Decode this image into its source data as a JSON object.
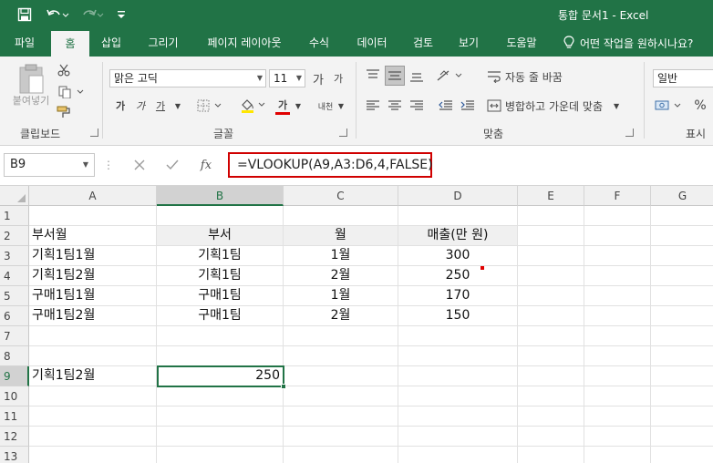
{
  "window": {
    "title": "통합 문서1  -  Excel"
  },
  "tabs": [
    {
      "label": "파일",
      "active": false
    },
    {
      "label": "홈",
      "active": true
    },
    {
      "label": "삽입",
      "active": false
    },
    {
      "label": "그리기",
      "active": false
    },
    {
      "label": "페이지 레이아웃",
      "active": false
    },
    {
      "label": "수식",
      "active": false
    },
    {
      "label": "데이터",
      "active": false
    },
    {
      "label": "검토",
      "active": false
    },
    {
      "label": "보기",
      "active": false
    },
    {
      "label": "도움말",
      "active": false
    }
  ],
  "tell_me": "어떤 작업을 원하시나요?",
  "ribbon": {
    "clipboard": {
      "paste_label": "붙여넣기",
      "group_label": "클립보드"
    },
    "font": {
      "font_name": "맑은 고딕",
      "font_size": "11",
      "grow_label": "가",
      "shrink_label": "가",
      "bold_label": "가",
      "italic_label": "가",
      "underline_label": "가",
      "fontcolor_label": "가",
      "phonetic_label": "내천",
      "group_label": "글꼴"
    },
    "alignment": {
      "wrap_label": "자동 줄 바꿈",
      "merge_label": "병합하고 가운데 맞춤",
      "group_label": "맞춤"
    },
    "number": {
      "format": "일반",
      "percent_label": "%",
      "group_label": "표시"
    }
  },
  "formula_bar": {
    "name_box": "B9",
    "fx_label": "fx",
    "formula": "=VLOOKUP(A9,A3:D6,4,FALSE)"
  },
  "columns": [
    "A",
    "B",
    "C",
    "D",
    "E",
    "F",
    "G"
  ],
  "selected_column": "B",
  "rows": [
    "1",
    "2",
    "3",
    "4",
    "5",
    "6",
    "7",
    "8",
    "9",
    "10",
    "11",
    "12",
    "13"
  ],
  "selected_row": "9",
  "cells": {
    "A2": "부서월",
    "B2": "부서",
    "C2": "월",
    "D2": "매출(만 원)",
    "A3": "기획1팀1월",
    "B3": "기획1팀",
    "C3": "1월",
    "D3": "300",
    "A4": "기획1팀2월",
    "B4": "기획1팀",
    "C4": "2월",
    "D4": "250",
    "A5": "구매1팀1월",
    "B5": "구매1팀",
    "C5": "1월",
    "D5": "170",
    "A6": "구매1팀2월",
    "B6": "구매1팀",
    "C6": "2월",
    "D6": "150",
    "A9": "기획1팀2월",
    "B9": "250"
  },
  "colors": {
    "excel_green": "#217346",
    "highlight_red": "#d00000"
  },
  "icons": {
    "save": "save-icon",
    "undo": "undo-icon",
    "redo": "redo-icon",
    "customize": "customize-qat-icon",
    "lightbulb": "lightbulb-icon",
    "cancel": "cancel-icon",
    "enter": "checkmark-icon"
  }
}
